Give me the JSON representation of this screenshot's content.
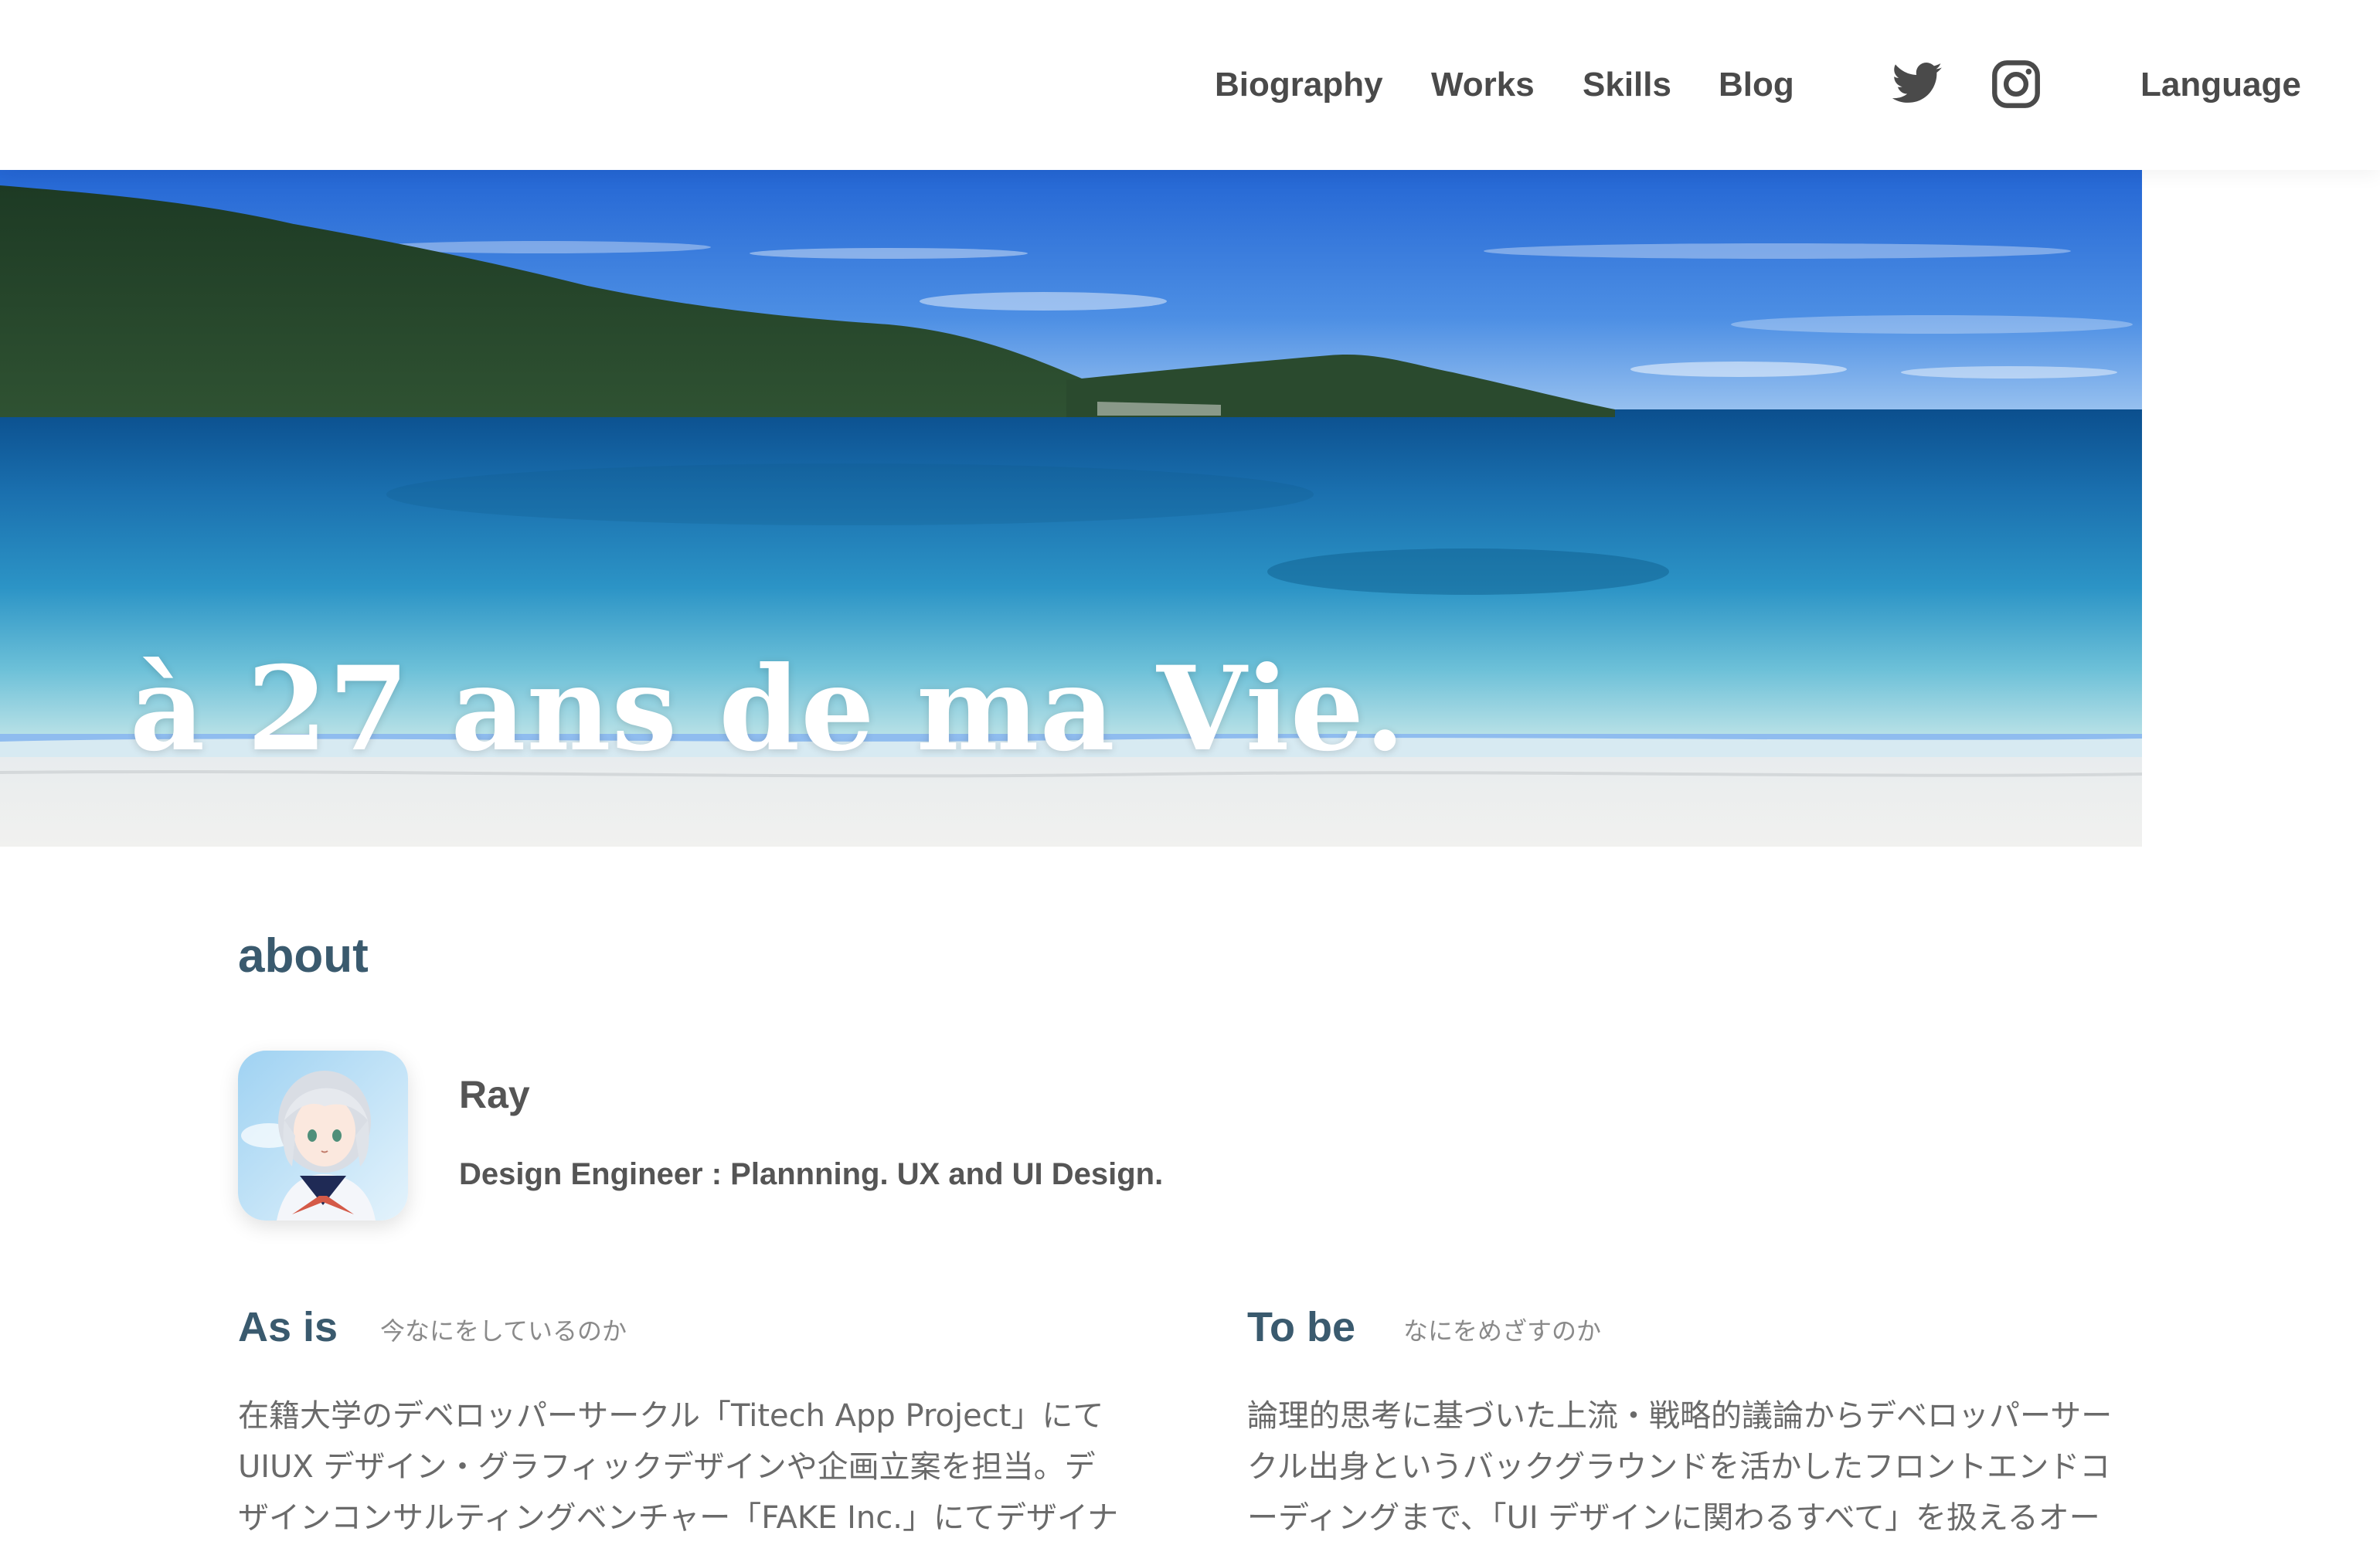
{
  "nav": {
    "items": [
      "Biography",
      "Works",
      "Skills",
      "Blog"
    ],
    "language_label": "Language",
    "social": [
      "twitter-icon",
      "instagram-icon"
    ]
  },
  "hero": {
    "title": "à 27 ans de ma Vie."
  },
  "about": {
    "title": "about",
    "name": "Ray",
    "role": "Design Engineer : Plannning. UX and UI Design."
  },
  "as_is": {
    "heading": "As is",
    "subheading": "今なにをしているのか",
    "lines": [
      "在籍大学のデベロッパーサークル「Titech App Project」にて",
      "UIUX デザイン・グラフィックデザインや企画立案を担当。デ",
      "ザインコンサルティングベンチャー「FAKE Inc.」にてデザイナ"
    ]
  },
  "to_be": {
    "heading": "To be",
    "subheading": "なにをめざすのか",
    "lines": [
      "論理的思考に基づいた上流・戦略的議論からデベロッパーサー",
      "クル出身というバックグラウンドを活かしたフロントエンドコ",
      "ーディングまで、「UI デザインに関わるすべて」を扱えるオー"
    ]
  },
  "colors": {
    "heading": "#3a5a6e",
    "text": "#4a4a4a",
    "muted": "#8a8a8a"
  }
}
